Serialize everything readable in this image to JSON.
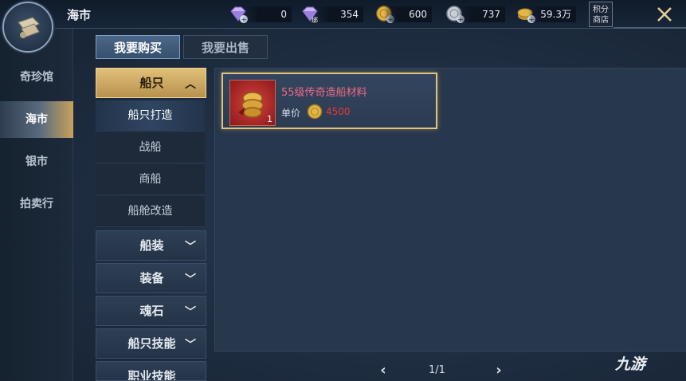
{
  "header": {
    "title": "海市",
    "currencies": [
      {
        "name": "diamond",
        "icon": "diamond-plus-icon",
        "value": "0"
      },
      {
        "name": "bound-diamond",
        "icon": "bound-diamond-icon",
        "badge": "绑",
        "value": "354"
      },
      {
        "name": "gold-coin",
        "icon": "gold-coin-plus-icon",
        "value": "600"
      },
      {
        "name": "silver-coin",
        "icon": "silver-coin-plus-icon",
        "value": "737"
      },
      {
        "name": "gold-stack",
        "icon": "gold-stack-plus-icon",
        "value": "59.3万"
      }
    ],
    "points_shop_label_1": "积分",
    "points_shop_label_2": "商店",
    "close_icon": "close-x-icon"
  },
  "sidebar": {
    "items": [
      {
        "label": "奇珍馆",
        "active": false
      },
      {
        "label": "海市",
        "active": true
      },
      {
        "label": "银市",
        "active": false
      },
      {
        "label": "拍卖行",
        "active": false
      }
    ]
  },
  "tabs": {
    "buy": "我要购买",
    "sell": "我要出售"
  },
  "categories": {
    "ship": {
      "label": "船只",
      "expanded": true,
      "subitems": [
        "船只打造",
        "战船",
        "商船",
        "船舱改造"
      ]
    },
    "ship_equip": {
      "label": "船装"
    },
    "equipment": {
      "label": "装备"
    },
    "soul_stone": {
      "label": "魂石"
    },
    "ship_skill": {
      "label": "船只技能"
    },
    "job_skill": {
      "label": "职业技能"
    }
  },
  "listing": {
    "name": "55级传奇造船材料",
    "quantity": "1",
    "unit_price_label": "单价",
    "price": "4500"
  },
  "pager": {
    "text": "1/1",
    "prev": "‹",
    "next": "›"
  },
  "watermark": "九游",
  "colors": {
    "accent_gold": "#e3c27a",
    "item_name": "#f06a84",
    "price": "#e8383e",
    "active_tab": "#4c6788"
  }
}
